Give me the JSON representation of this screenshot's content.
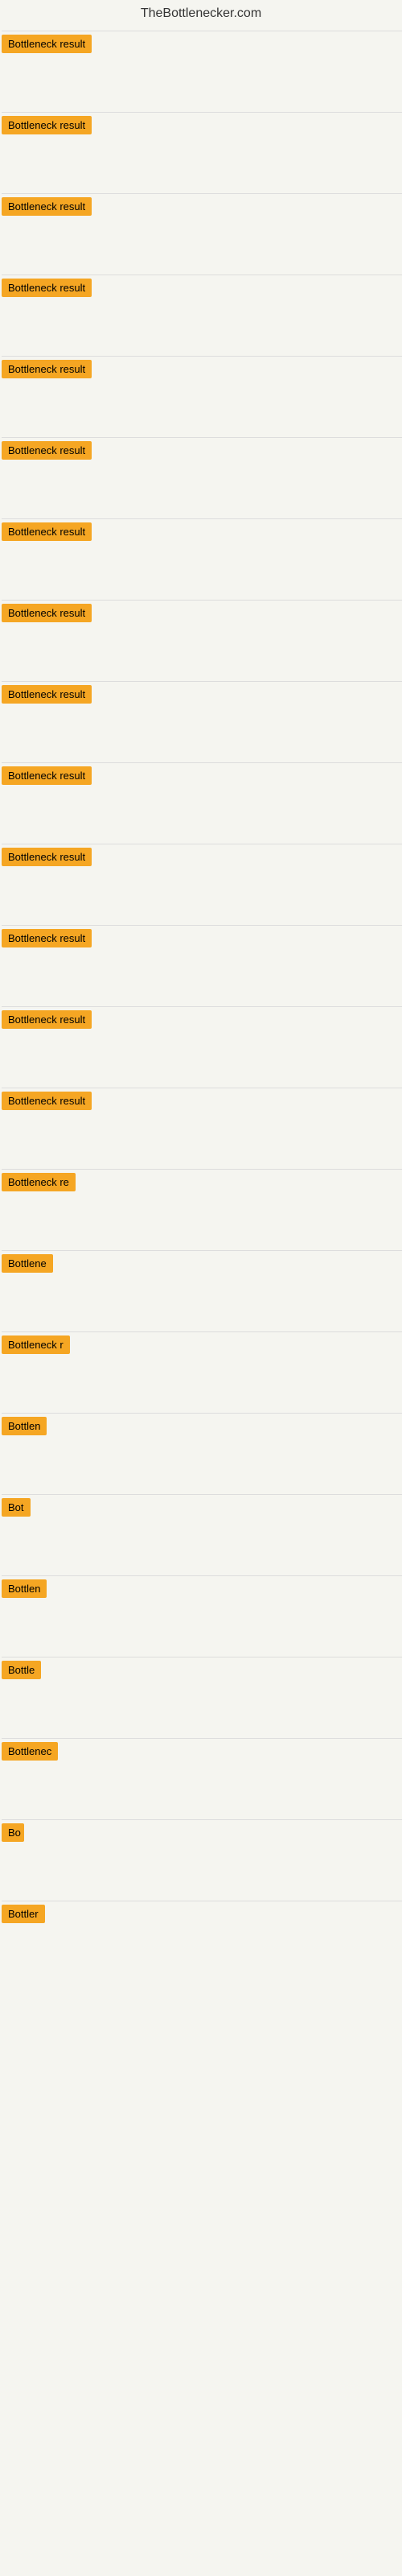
{
  "site": {
    "title": "TheBottlenecker.com"
  },
  "items": [
    {
      "id": 1,
      "label": "Bottleneck result",
      "badge_width": 115
    },
    {
      "id": 2,
      "label": "Bottleneck result",
      "badge_width": 115
    },
    {
      "id": 3,
      "label": "Bottleneck result",
      "badge_width": 115
    },
    {
      "id": 4,
      "label": "Bottleneck result",
      "badge_width": 115
    },
    {
      "id": 5,
      "label": "Bottleneck result",
      "badge_width": 115
    },
    {
      "id": 6,
      "label": "Bottleneck result",
      "badge_width": 115
    },
    {
      "id": 7,
      "label": "Bottleneck result",
      "badge_width": 115
    },
    {
      "id": 8,
      "label": "Bottleneck result",
      "badge_width": 115
    },
    {
      "id": 9,
      "label": "Bottleneck result",
      "badge_width": 115
    },
    {
      "id": 10,
      "label": "Bottleneck result",
      "badge_width": 115
    },
    {
      "id": 11,
      "label": "Bottleneck result",
      "badge_width": 115
    },
    {
      "id": 12,
      "label": "Bottleneck result",
      "badge_width": 115
    },
    {
      "id": 13,
      "label": "Bottleneck result",
      "badge_width": 115
    },
    {
      "id": 14,
      "label": "Bottleneck result",
      "badge_width": 115
    },
    {
      "id": 15,
      "label": "Bottleneck re",
      "badge_width": 95
    },
    {
      "id": 16,
      "label": "Bottlene",
      "badge_width": 72
    },
    {
      "id": 17,
      "label": "Bottleneck r",
      "badge_width": 88
    },
    {
      "id": 18,
      "label": "Bottlen",
      "badge_width": 65
    },
    {
      "id": 19,
      "label": "Bot",
      "badge_width": 38
    },
    {
      "id": 20,
      "label": "Bottlen",
      "badge_width": 65
    },
    {
      "id": 21,
      "label": "Bottle",
      "badge_width": 55
    },
    {
      "id": 22,
      "label": "Bottlenec",
      "badge_width": 75
    },
    {
      "id": 23,
      "label": "Bo",
      "badge_width": 28
    },
    {
      "id": 24,
      "label": "Bottler",
      "badge_width": 55
    }
  ]
}
